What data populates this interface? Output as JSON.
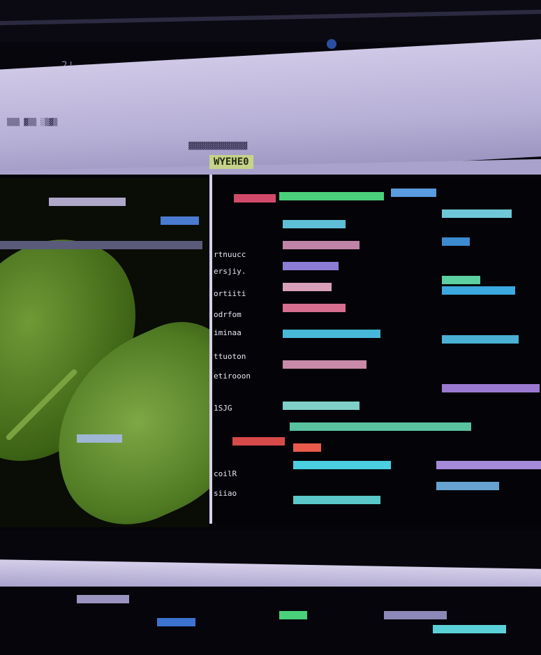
{
  "tab": {
    "label": "WYEHE0"
  },
  "top": {
    "label": "2¦"
  },
  "code_lines_left": [
    "rtnuucc",
    "ersjiy.",
    "ortiiti",
    "odrfom",
    "iminaa",
    "ttuoton",
    "etirooon",
    "1SJG",
    "coilR",
    "siiao"
  ],
  "colors": {
    "accent_green": "#6f9a36",
    "chrome": "#b7b0d6",
    "background": "#07060d"
  }
}
